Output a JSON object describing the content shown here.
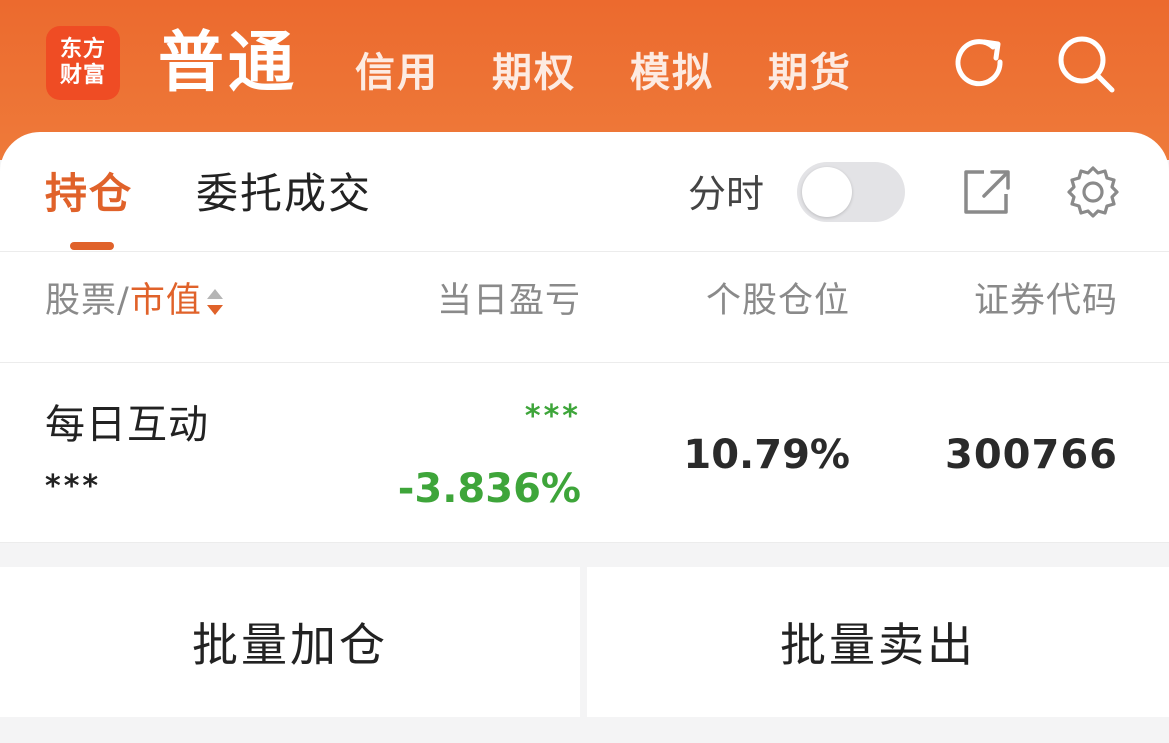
{
  "header": {
    "logo_line1": "东方",
    "logo_line2": "财富",
    "active_tab": "普通",
    "tabs": [
      "信用",
      "期权",
      "模拟",
      "期货"
    ],
    "refresh_icon": "refresh-icon",
    "search_icon": "search-icon"
  },
  "subtabs": {
    "holdings": "持仓",
    "orders": "委托成交",
    "toggle_label": "分时",
    "toggle_on": false,
    "export_icon": "share-export-icon",
    "settings_icon": "gear-icon"
  },
  "columns": {
    "stock": "股票",
    "separator": "/",
    "market_value": "市值",
    "daily_pnl": "当日盈亏",
    "position_ratio": "个股仓位",
    "code": "证券代码"
  },
  "rows": [
    {
      "name": "每日互动",
      "market_value": "***",
      "pnl_amount": "***",
      "pnl_percent": "-3.836%",
      "position_ratio": "10.79%",
      "code": "300766"
    }
  ],
  "buttons": {
    "batch_add": "批量加仓",
    "batch_sell": "批量卖出"
  },
  "colors": {
    "header_orange": "#ec6a2e",
    "accent": "#e0622a",
    "loss_green": "#3ea53a"
  }
}
